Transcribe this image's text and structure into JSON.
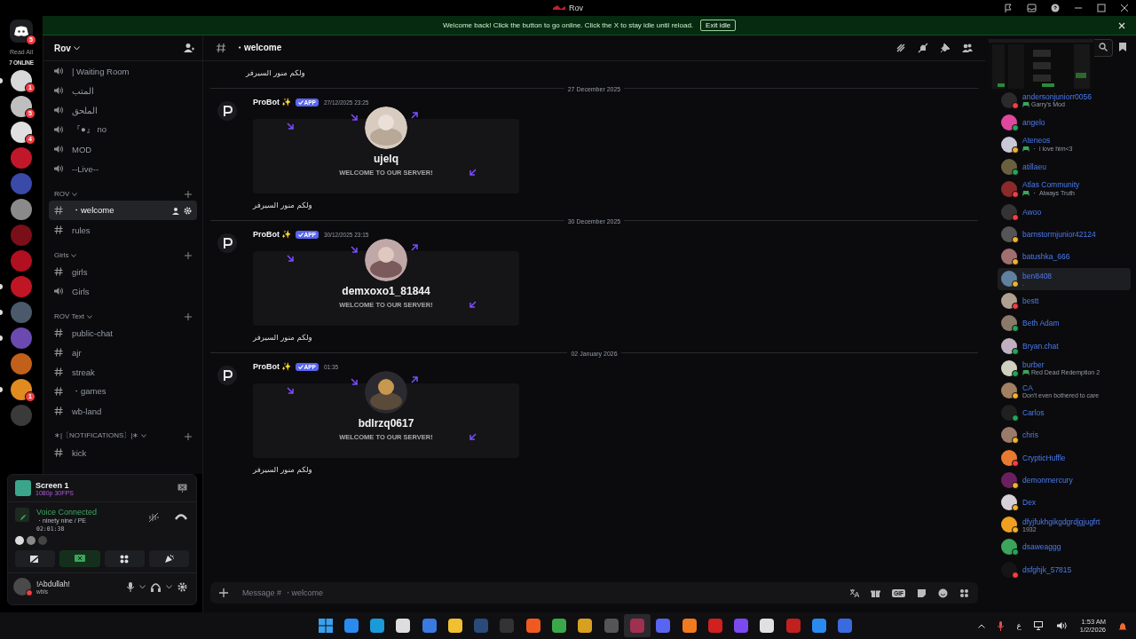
{
  "window": {
    "title": "Rov"
  },
  "notice": {
    "text": "Welcome back! Click the button to go online. Click the X to stay idle until reload.",
    "button": "Exit idle"
  },
  "rail": {
    "home_badge": "5",
    "read_all": "Read All",
    "online": "7 ONLINE",
    "servers": [
      {
        "color": "#d8d8d8",
        "badge": "1",
        "unread": true
      },
      {
        "color": "#bfbfbf",
        "badge": "5",
        "unread": false
      },
      {
        "color": "#e0e0e0",
        "badge": "4",
        "unread": false
      },
      {
        "color": "#c0182a",
        "unread": false
      },
      {
        "color": "#3a4aa8",
        "unread": false
      },
      {
        "color": "#8a8a8a",
        "unread": false
      },
      {
        "color": "#7a0f1a",
        "unread": false
      },
      {
        "color": "#b01020",
        "unread": false
      },
      {
        "color": "#c01525",
        "unread": true
      },
      {
        "color": "#4a5a6a",
        "unread": true
      },
      {
        "color": "#6a4ab0",
        "unread": true
      },
      {
        "color": "#c0601a",
        "unread": false
      },
      {
        "color": "#e08a20",
        "badge": "1",
        "unread": true
      },
      {
        "color": "#3a3a3a",
        "unread": false
      }
    ]
  },
  "server": {
    "name": "Rov"
  },
  "channels": [
    {
      "kind": "voice",
      "name": "| Waiting Room"
    },
    {
      "kind": "voice",
      "name": "المتب"
    },
    {
      "kind": "voice",
      "name": "الملحق"
    },
    {
      "kind": "voice",
      "name": "『●』 no"
    },
    {
      "kind": "voice",
      "name": "MOD"
    },
    {
      "kind": "voice",
      "name": "--Live--"
    },
    {
      "kind": "category",
      "name": "ROV"
    },
    {
      "kind": "text",
      "name": "・welcome",
      "selected": true
    },
    {
      "kind": "text",
      "name": "rules",
      "selected": false
    },
    {
      "kind": "category",
      "name": "Girls"
    },
    {
      "kind": "text",
      "name": "girls",
      "selected": false
    },
    {
      "kind": "voice",
      "name": "Girls"
    },
    {
      "kind": "category",
      "name": "ROV Text"
    },
    {
      "kind": "text",
      "name": "public-chat",
      "selected": false
    },
    {
      "kind": "text",
      "name": "ajr",
      "selected": false
    },
    {
      "kind": "text",
      "name": "streak",
      "selected": false
    },
    {
      "kind": "text",
      "name": "・games",
      "selected": false
    },
    {
      "kind": "text",
      "name": "wb-land",
      "selected": false
    },
    {
      "kind": "category",
      "name": "∗|〔NOTIFICATIONS〕|∗"
    },
    {
      "kind": "text",
      "name": "kick",
      "selected": false
    }
  ],
  "stream": {
    "title": "Screen 1",
    "quality": "1080p 30FPS"
  },
  "voice": {
    "status": "Voice Connected",
    "channel": "・ninety nine / PE",
    "time": "02:01:38"
  },
  "user": {
    "name": "!Abdullah!",
    "status": "wbls"
  },
  "chat": {
    "channel": "・welcome",
    "top_text": "ولكم منور السيرفر",
    "messages": [
      {
        "date": "27 December 2025",
        "author": "ProBot ✨",
        "badge": "APP",
        "time": "27/12/2025 23:25",
        "card_name": "ujelq",
        "card_text": "WELCOME TO OUR SERVER!",
        "text": "ولكم منور السيرفر"
      },
      {
        "date": "30 December 2025",
        "author": "ProBot ✨",
        "badge": "APP",
        "time": "30/12/2025 23:15",
        "card_name": "demxoxo1_81844",
        "card_text": "WELCOME TO OUR SERVER!",
        "text": "ولكم منور السيرفر"
      },
      {
        "date": "02 January 2026",
        "author": "ProBot ✨",
        "badge": "APP",
        "time": "01:35",
        "card_name": "bdlrzq0617",
        "card_text": "WELCOME TO OUR SERVER!",
        "text": "ولكم منور السيرفر"
      }
    ],
    "placeholder": "Message # ・welcome",
    "gif": "GIF"
  },
  "members": [
    {
      "name": "andersonjuniorr0056",
      "activity": "Garry's Mod",
      "game": true,
      "color": "#f23f43",
      "selected": false
    },
    {
      "name": "angelo",
      "color": "#23a55a",
      "selected": false
    },
    {
      "name": "Ateneos",
      "activity": "・ i love him<3",
      "game": true,
      "color": "#f0b232",
      "selected": false
    },
    {
      "name": "atillaeu",
      "color": "#23a55a",
      "selected": false
    },
    {
      "name": "Atlas Community",
      "activity": "・ Always Truth",
      "game": true,
      "color": "#f23f43",
      "selected": false
    },
    {
      "name": "Awoo",
      "color": "#f23f43",
      "selected": false
    },
    {
      "name": "barnstormjunior42124",
      "color": "#f0b232",
      "selected": false
    },
    {
      "name": "batushka_666",
      "color": "#f0b232",
      "selected": false
    },
    {
      "name": "ben8408",
      "activity": ".",
      "game": false,
      "color": "#f0b232",
      "selected": true
    },
    {
      "name": "bestt",
      "color": "#f23f43",
      "selected": false
    },
    {
      "name": "Beth Adam",
      "color": "#23a55a",
      "selected": false
    },
    {
      "name": "Bryan.chat",
      "color": "#23a55a",
      "selected": false
    },
    {
      "name": "burber",
      "activity": "Red Dead Redemption 2",
      "game": true,
      "color": "#23a55a",
      "selected": false
    },
    {
      "name": "CA",
      "activity": "Don't even bothered to care",
      "game": false,
      "color": "#f0b232",
      "selected": false
    },
    {
      "name": "Carlos",
      "color": "#23a55a",
      "selected": false
    },
    {
      "name": "chris",
      "color": "#f0b232",
      "selected": false
    },
    {
      "name": "CrypticHuffle",
      "color": "#f23f43",
      "selected": false
    },
    {
      "name": "demonmercury",
      "color": "#f0b232",
      "selected": false
    },
    {
      "name": "Dex",
      "color": "#f0b232",
      "selected": false
    },
    {
      "name": "dfyjfukhgikgdgrdjgjugfrt",
      "activity": "1932",
      "game": false,
      "color": "#f0b232",
      "selected": false
    },
    {
      "name": "dsaweaggg",
      "color": "#23a55a",
      "selected": false
    },
    {
      "name": "dsfghjk_57815",
      "color": "#f23f43",
      "selected": false
    }
  ],
  "taskbar": {
    "apps": [
      {
        "color": "#2a8af0"
      },
      {
        "color": "#1a9ad8"
      },
      {
        "color": "#dddddd"
      },
      {
        "color": "#3a7ae0"
      },
      {
        "color": "#f0c030"
      },
      {
        "color": "#2a4a7a"
      },
      {
        "color": "#333333"
      },
      {
        "color": "#f05a20"
      },
      {
        "color": "#3aa84a"
      },
      {
        "color": "#d8a020"
      },
      {
        "color": "#555555"
      },
      {
        "color": "#a03050",
        "selected": true
      },
      {
        "color": "#5865f2"
      },
      {
        "color": "#f07a20"
      },
      {
        "color": "#d02020"
      },
      {
        "color": "#7a4af0"
      },
      {
        "color": "#e0e0e0"
      },
      {
        "color": "#c02020"
      },
      {
        "color": "#2a8af0"
      },
      {
        "color": "#3a6ae0"
      }
    ],
    "lang": "ع",
    "time": "1:53 AM",
    "date": "1/2/2026"
  }
}
